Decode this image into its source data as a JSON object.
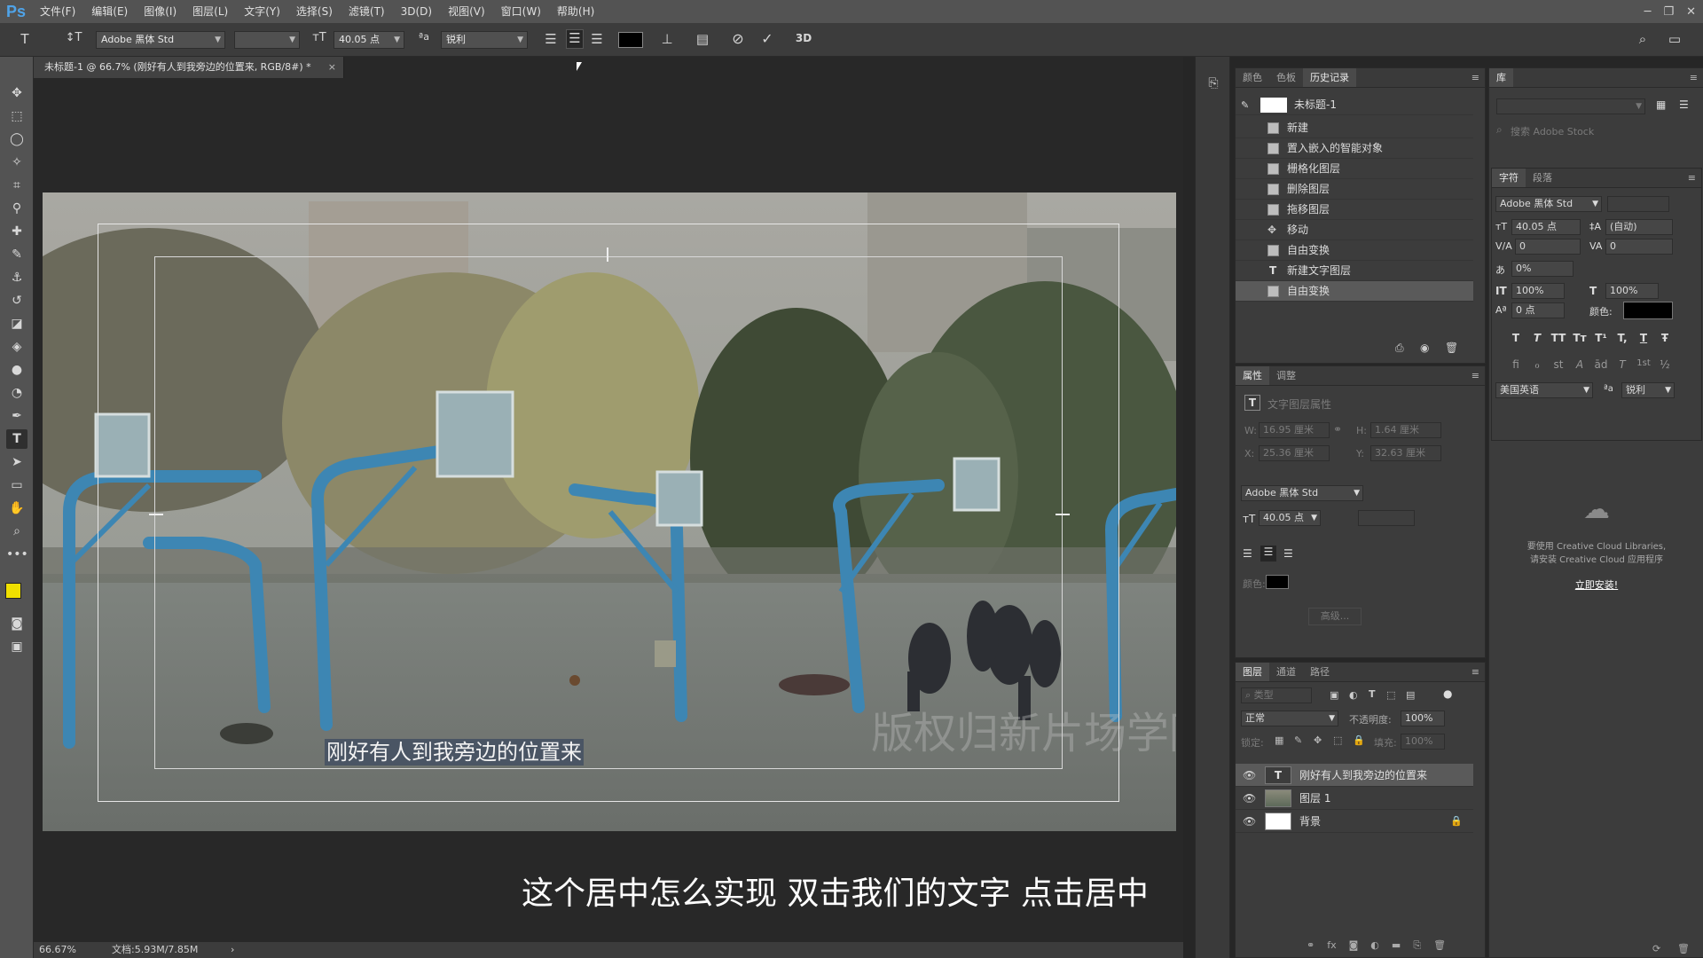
{
  "app": {
    "logo": "Ps"
  },
  "menu": [
    "文件(F)",
    "编辑(E)",
    "图像(I)",
    "图层(L)",
    "文字(Y)",
    "选择(S)",
    "滤镜(T)",
    "3D(D)",
    "视图(V)",
    "窗口(W)",
    "帮助(H)"
  ],
  "options": {
    "font_family": "Adobe 黑体 Std",
    "font_size": "40.05 点",
    "aa_label": "ªa",
    "antialias": "锐利",
    "text_color": "#000000",
    "threed_label": "3D"
  },
  "document": {
    "tab_title": "未标题-1 @ 66.7% (刚好有人到我旁边的位置来, RGB/8#) *",
    "caption_text": "刚好有人到我旁边的位置来",
    "watermark": "版权归新片场学院所有",
    "subtitle": "这个居中怎么实现 双击我们的文字 点击居中"
  },
  "status": {
    "zoom": "66.67%",
    "doc_size": "文档:5.93M/7.85M"
  },
  "history": {
    "tabs": [
      "颜色",
      "色板",
      "历史记录"
    ],
    "snapshot": "未标题-1",
    "items": [
      "新建",
      "置入嵌入的智能对象",
      "栅格化图层",
      "删除图层",
      "拖移图层",
      "移动",
      "自由变换",
      "新建文字图层",
      "自由变换"
    ]
  },
  "properties": {
    "tabs": [
      "属性",
      "调整"
    ],
    "title": "文字图层属性",
    "w_label": "W:",
    "w_value": "16.95 厘米",
    "h_label": "H:",
    "h_value": "1.64 厘米",
    "x_label": "X:",
    "x_value": "25.36 厘米",
    "y_label": "Y:",
    "y_value": "32.63 厘米",
    "font_family": "Adobe 黑体 Std",
    "font_size": "40.05 点",
    "color_label": "颜色:",
    "advanced_label": "高级..."
  },
  "layers": {
    "tabs": [
      "图层",
      "通道",
      "路径"
    ],
    "filter_label": "类型",
    "blend_mode": "正常",
    "opacity_label": "不透明度:",
    "opacity": "100%",
    "lock_label": "锁定:",
    "fill_label": "填充:",
    "fill": "100%",
    "items": [
      "刚好有人到我旁边的位置来",
      "图层 1",
      "背景"
    ]
  },
  "library": {
    "tab": "库",
    "search_placeholder": "搜索 Adobe Stock",
    "message_line1": "要使用 Creative Cloud Libraries,",
    "message_line2": "请安装 Creative Cloud 应用程序",
    "install_link": "立即安装!"
  },
  "character": {
    "tabs": [
      "字符",
      "段落"
    ],
    "font_family": "Adobe 黑体 Std",
    "font_size": "40.05 点",
    "leading": "(自动)",
    "kerning": "0",
    "tracking": "0",
    "scale_percent": "0%",
    "vscale": "100%",
    "hscale": "100%",
    "baseline": "0 点",
    "color_label": "颜色:",
    "language": "美国英语",
    "aa_label": "ªa",
    "antialias": "锐利",
    "style_buttons": [
      "T",
      "T",
      "TT",
      "Tт",
      "T¹",
      "T,",
      "T",
      "Ŧ"
    ],
    "opentype_buttons": [
      "fi",
      "ℴ",
      "st",
      "A",
      "ād",
      "T",
      "1st",
      "½"
    ]
  }
}
